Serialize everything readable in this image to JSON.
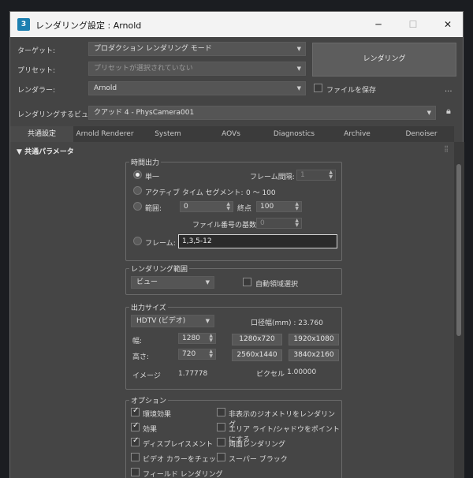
{
  "window": {
    "title": "レンダリング設定 : Arnold",
    "app_icon": "3",
    "minimize": "─",
    "maximize": "☐",
    "close": "✕"
  },
  "header": {
    "target_label": "ターゲット:",
    "target_value": "プロダクション レンダリング モード",
    "preset_label": "プリセット:",
    "preset_value": "プリセットが選択されていない",
    "renderer_label": "レンダラー:",
    "renderer_value": "Arnold",
    "save_file_label": "ファイルを保存",
    "render_button": "レンダリング",
    "more": "...",
    "view_label": "レンダリングするビュー:",
    "view_value": "クアッド 4 - PhysCamera001",
    "lock_icon": "lock-icon"
  },
  "tabs": [
    "共通設定",
    "Arnold Renderer",
    "System",
    "AOVs",
    "Diagnostics",
    "Archive",
    "Denoiser"
  ],
  "active_tab": 0,
  "rollout": {
    "title": "共通パラメータ",
    "toggle": "▼"
  },
  "time_output": {
    "title": "時間出力",
    "single": "単一",
    "frame_interval_label": "フレーム間隔:",
    "frame_interval_value": "1",
    "active_segment": "アクティブ タイム セグメント:",
    "active_segment_value": "0 〜 100",
    "range": "範囲:",
    "range_from": "0",
    "range_to_label": "終点",
    "range_to": "100",
    "file_base_label": "ファイル番号の基数:",
    "file_base_value": "0",
    "frames": "フレーム:",
    "frames_value": "1,3,5-12"
  },
  "render_area": {
    "title": "レンダリング範囲",
    "value": "ビュー",
    "auto_region": "自動領域選択"
  },
  "output_size": {
    "title": "出力サイズ",
    "preset": "HDTV (ビデオ)",
    "aperture": "口径幅(mm) : 23.760",
    "width_label": "幅:",
    "width_value": "1280",
    "height_label": "高さ:",
    "height_value": "720",
    "presets": [
      "1280x720",
      "1920x1080",
      "2560x1440",
      "3840x2160"
    ],
    "image_label": "イメージ",
    "image_value": "1.77778",
    "pixel_label": "ピクセル",
    "pixel_value": "1.00000"
  },
  "options": {
    "title": "オプション",
    "items_left": [
      {
        "label": "環境効果",
        "checked": true
      },
      {
        "label": "効果",
        "checked": true
      },
      {
        "label": "ディスプレイスメント",
        "checked": true
      },
      {
        "label": "ビデオ カラーをチェック",
        "checked": false
      },
      {
        "label": "フィールド レンダリング",
        "checked": false
      }
    ],
    "items_right": [
      {
        "label": "非表示のジオメトリをレンダリング",
        "checked": false
      },
      {
        "label": "エリア ライト/シャドウをポイントにする",
        "checked": false
      },
      {
        "label": "両面レンダリング",
        "checked": false
      },
      {
        "label": "スーパー ブラック",
        "checked": false
      }
    ]
  }
}
